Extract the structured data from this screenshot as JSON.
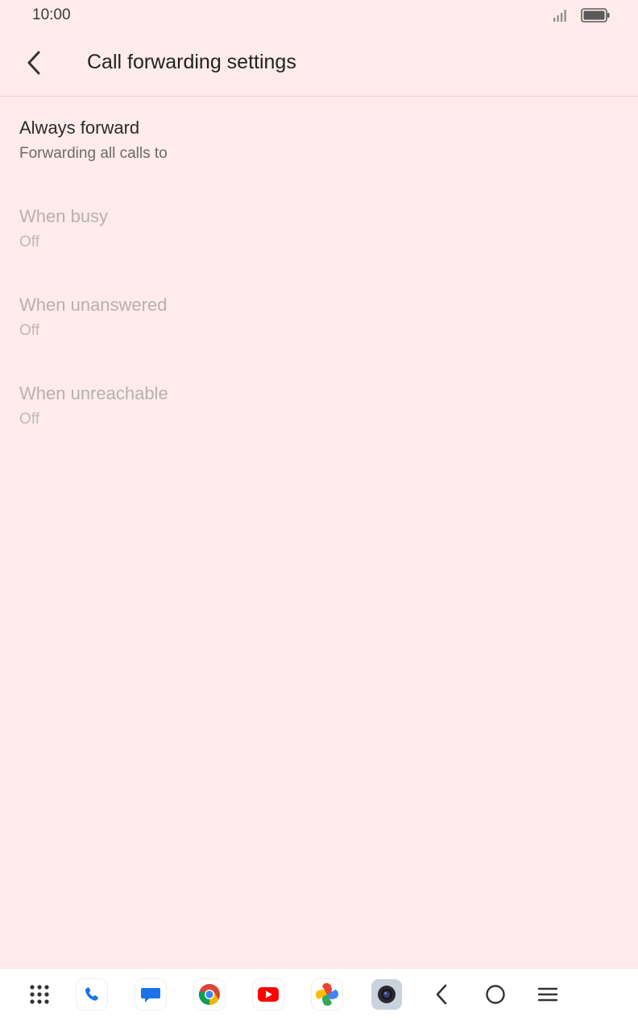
{
  "status_bar": {
    "time": "10:00"
  },
  "header": {
    "title": "Call forwarding settings"
  },
  "settings": [
    {
      "title": "Always forward",
      "subtitle": "Forwarding all calls to",
      "enabled": true
    },
    {
      "title": "When busy",
      "subtitle": "Off",
      "enabled": false
    },
    {
      "title": "When unanswered",
      "subtitle": "Off",
      "enabled": false
    },
    {
      "title": "When unreachable",
      "subtitle": "Off",
      "enabled": false
    }
  ],
  "nav_bar": {
    "items": [
      "app-drawer-icon",
      "phone-icon",
      "messages-icon",
      "chrome-icon",
      "youtube-icon",
      "photos-icon",
      "camera-icon",
      "back-icon",
      "home-icon",
      "recents-menu-icon"
    ]
  },
  "colors": {
    "background": "#ffecea",
    "nav_background": "#ffffff",
    "disabled_text": "#b9b0af"
  }
}
